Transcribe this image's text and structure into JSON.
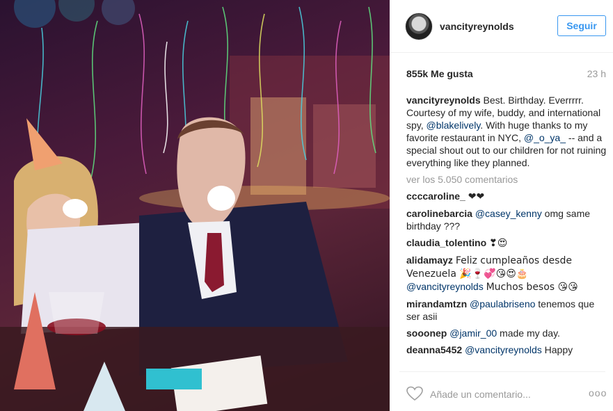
{
  "post": {
    "username": "vancityreynolds",
    "follow_label": "Seguir",
    "likes": "855k Me gusta",
    "time": "23 h",
    "caption": {
      "user": "vancityreynolds",
      "part1": "Best. Birthday. Everrrrr. Courtesy of my wife, buddy, and international spy, ",
      "mention1": "@blakelively",
      "part2": ". With huge thanks to my favorite restaurant in NYC, ",
      "mention2": "@_o_ya_",
      "part3": " -- and a special shout out to our children for not ruining everything like they planned."
    },
    "view_all": "ver los 5.050 comentarios",
    "comments": [
      {
        "user": "ccccaroline_",
        "mention": "",
        "text": "❤❤"
      },
      {
        "user": "carolinebarcia",
        "mention": "@casey_kenny",
        "text": "omg same birthday ???"
      },
      {
        "user": "claudia_tolentino",
        "mention": "",
        "text": "❣😍"
      },
      {
        "user": "alidamayz",
        "mention": "",
        "text": "Feliz cumpleaños desde Venezuela 🎉🍷💞😘😍🎂"
      },
      {
        "user": "",
        "mention": "@vancityreynolds",
        "text": "Muchos besos 😘😘"
      },
      {
        "user": "mirandamtzn",
        "mention": "@paulabriseno",
        "text": "tenemos que ser asii"
      },
      {
        "user": "sooonep",
        "mention": "@jamir_00",
        "text": "made my day."
      },
      {
        "user": "deanna5452",
        "mention": "@vancityreynolds",
        "text": "Happy"
      }
    ],
    "add_comment_placeholder": "Añade un comentario...",
    "more_label": "ooo"
  },
  "icons": {
    "heart": "heart-icon",
    "more": "more-options-icon",
    "avatar": "avatar"
  },
  "colors": {
    "accent": "#3897f0",
    "mention": "#003569",
    "muted": "#999999"
  }
}
